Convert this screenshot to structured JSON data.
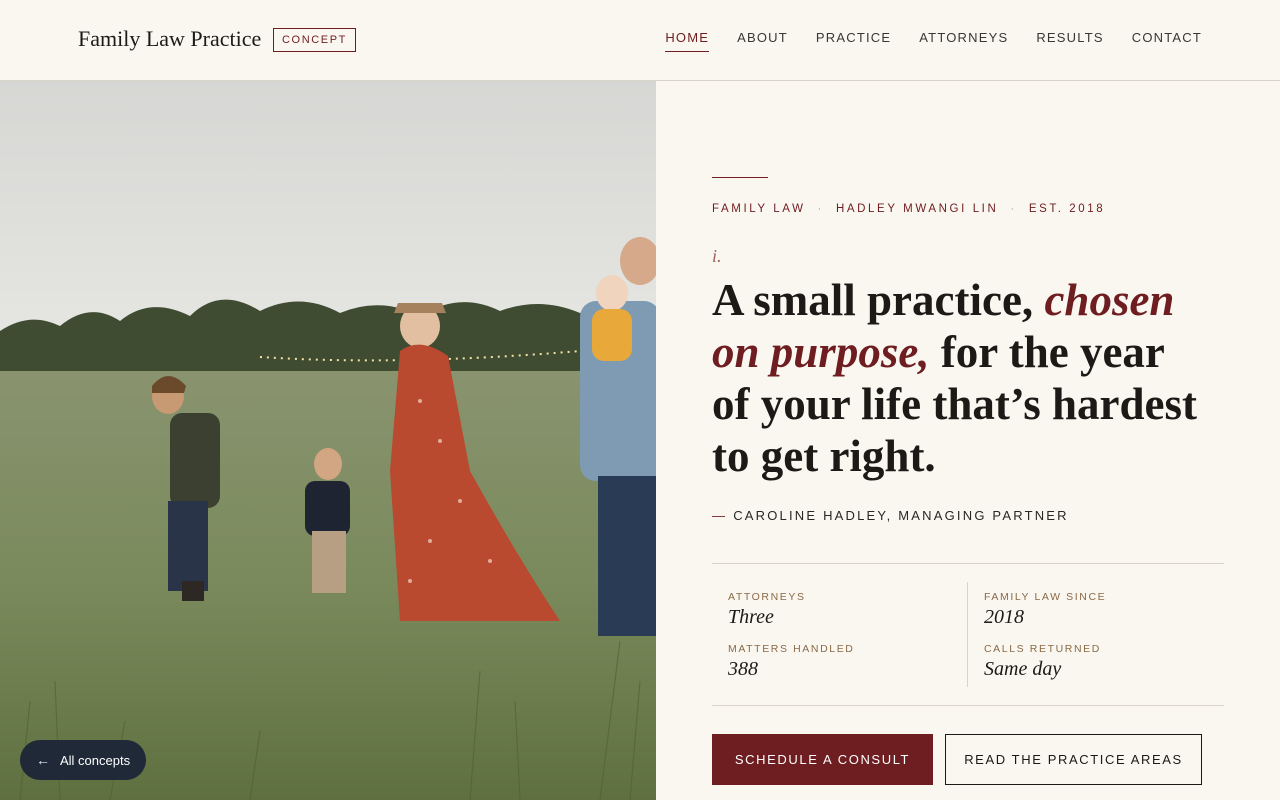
{
  "header": {
    "brand": "Family Law Practice",
    "badge": "CONCEPT",
    "nav": [
      {
        "label": "HOME",
        "active": true
      },
      {
        "label": "ABOUT"
      },
      {
        "label": "PRACTICE"
      },
      {
        "label": "ATTORNEYS"
      },
      {
        "label": "RESULTS"
      },
      {
        "label": "CONTACT"
      }
    ]
  },
  "hero": {
    "eyebrow": [
      "FAMILY LAW",
      "HADLEY MWANGI LIN",
      "EST. 2018"
    ],
    "eyebrow_sep": "·",
    "numeral": "i.",
    "headline_part1": "A small practice, ",
    "headline_accent": "chosen on purpose,",
    "headline_part2": " for the year of your life that’s hardest to get right.",
    "attribution_dash": "—",
    "attribution": "CAROLINE HADLEY, MANAGING PARTNER",
    "stats": [
      {
        "label": "ATTORNEYS",
        "value": "Three"
      },
      {
        "label": "MATTERS HANDLED",
        "value": "388"
      },
      {
        "label": "FAMILY LAW SINCE",
        "value": "2018"
      },
      {
        "label": "CALLS RETURNED",
        "value": "Same day"
      }
    ],
    "primary_cta": "SCHEDULE A CONSULT",
    "secondary_cta": "READ THE PRACTICE AREAS"
  },
  "photo": {
    "icon": "family-photo"
  },
  "floating": {
    "icon": "arrow-left-icon",
    "label": "All concepts"
  },
  "colors": {
    "accent": "#6e1d21",
    "background": "#faf7f1",
    "pill": "#1f2937"
  }
}
